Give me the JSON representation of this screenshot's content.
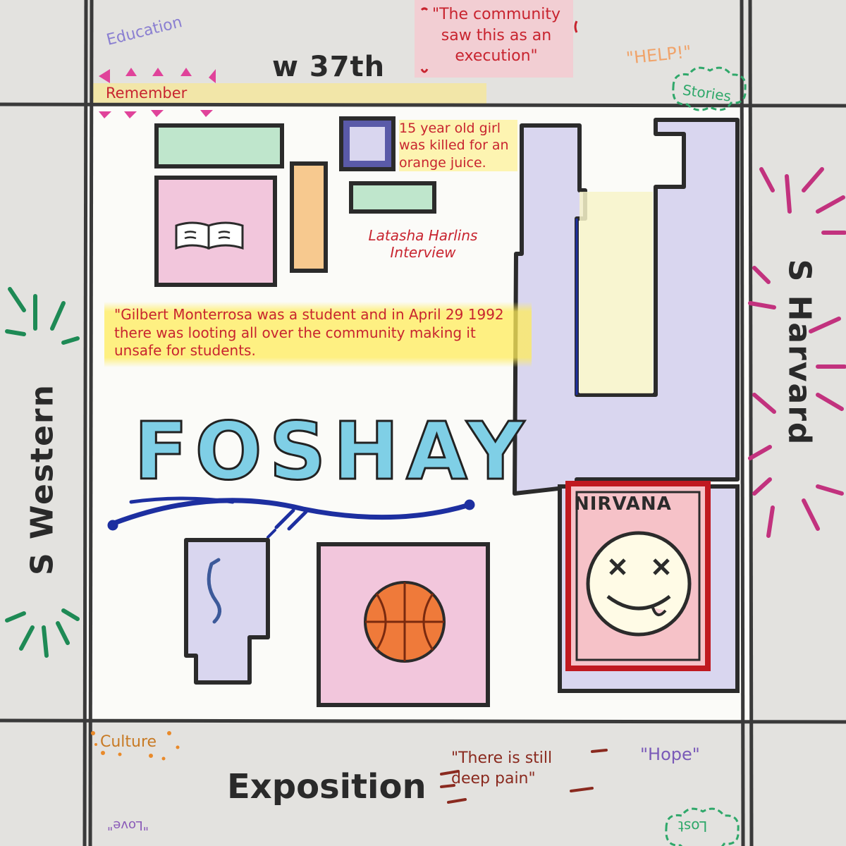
{
  "streets": {
    "north": "w 37th",
    "south": "Exposition",
    "west": "S Western",
    "east": "S Harvard"
  },
  "margin_words": {
    "education": "Education",
    "remember": "Remember",
    "help": "\"HELP!\"",
    "stories": "Stories",
    "culture": "Culture",
    "hope": "\"Hope\"",
    "love": "\"Love\"",
    "lost": "Lost"
  },
  "quotes": {
    "execution": "\"The community saw this as an execution\"",
    "deep_pain": "\"There is still deep pain\""
  },
  "notes": {
    "latasha": "15 year old girl was killed for an orange juice.",
    "interview": "Latasha Harlins Interview",
    "gilbert": "\"Gilbert Monterrosa was a student and in April 29 1992 there was looting all over the community making it unsafe for students."
  },
  "school_name": "FOSHAY",
  "poster_text": "NIRVANA",
  "colors": {
    "road_line": "#3a3a3a",
    "building_outline": "#2b2b2b",
    "note_red": "#c8242f",
    "highlight_yellow": "#ffe95a",
    "foshay_blue": "#7fcfe6",
    "navy": "#1d2fa0",
    "pink_fill": "#f2c6dc",
    "green_fill": "#bfe6cc",
    "lavender_fill": "#d9d6ef",
    "orange_fill": "#f7c98f",
    "cream_fill": "#f7f3c9"
  }
}
